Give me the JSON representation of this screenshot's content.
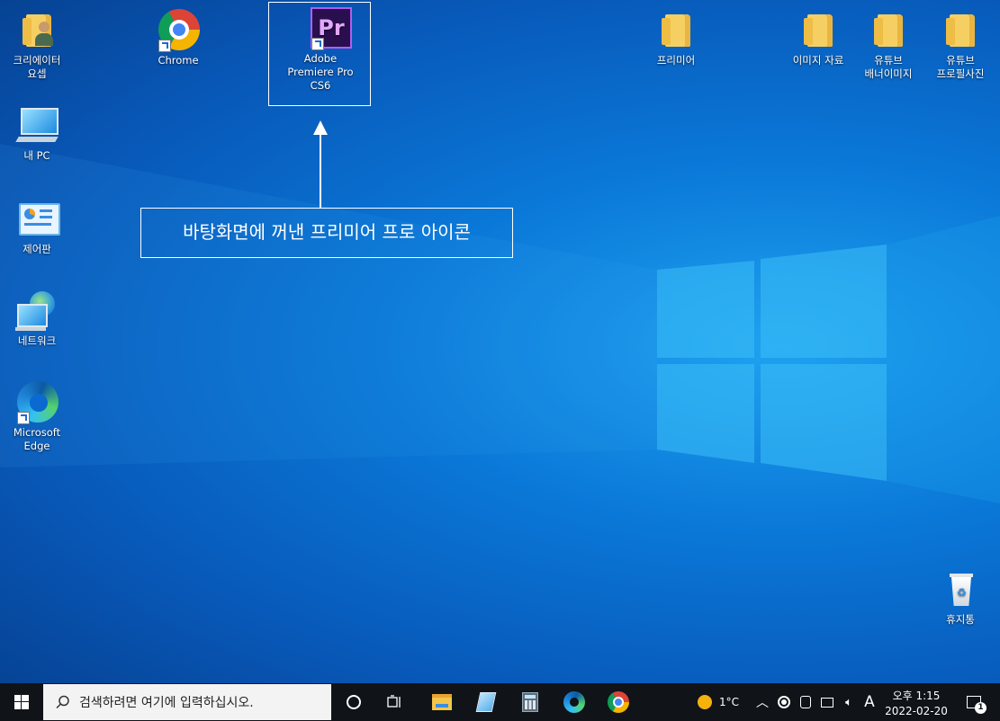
{
  "desktop": {
    "icons": [
      {
        "label": "크리에이터\n요셉"
      },
      {
        "label": "Chrome"
      },
      {
        "label": "Adobe\nPremiere Pro\nCS6"
      },
      {
        "label": "내 PC"
      },
      {
        "label": "제어판"
      },
      {
        "label": "네트워크"
      },
      {
        "label": "Microsoft\nEdge"
      },
      {
        "label": "프리미어"
      },
      {
        "label": "이미지 자료"
      },
      {
        "label": "유튜브\n배너이미지"
      },
      {
        "label": "유튜브\n프로필사진"
      },
      {
        "label": "휴지통"
      }
    ],
    "premiere_glyph": "Pr",
    "callout": "바탕화면에 꺼낸 프리미어 프로 아이콘"
  },
  "taskbar": {
    "search_placeholder": "검색하려면 여기에 입력하십시오.",
    "weather": "1°C",
    "ime": "A",
    "time": "오후 1:15",
    "date": "2022-02-20",
    "notification_count": "1"
  },
  "colors": {
    "accent": "#0a78d8",
    "premiere": "#2a0f4e",
    "premiere_text": "#e2a8ff"
  }
}
